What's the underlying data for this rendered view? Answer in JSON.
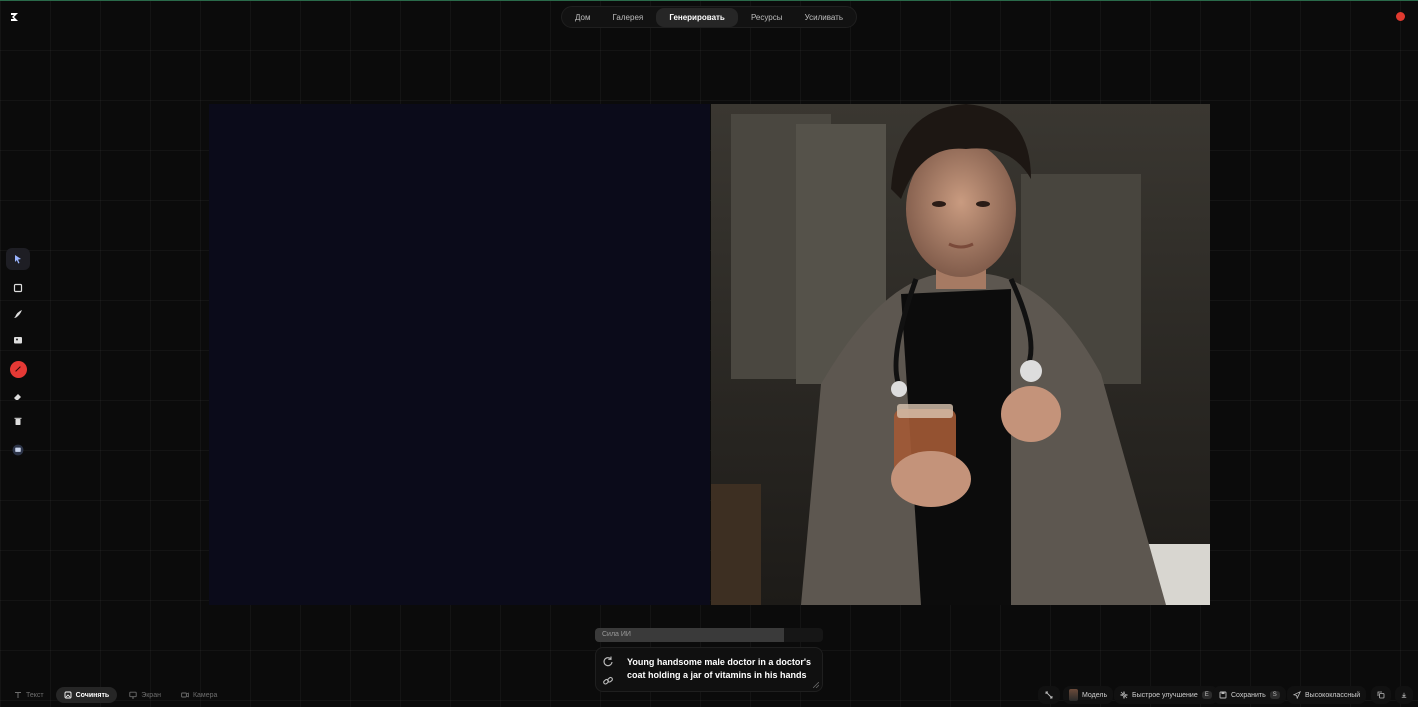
{
  "header": {
    "tabs": [
      {
        "label": "Дом"
      },
      {
        "label": "Галерея"
      },
      {
        "label": "Генерировать",
        "active": true
      },
      {
        "label": "Ресурсы"
      },
      {
        "label": "Усиливать"
      }
    ],
    "accent_color": "#e03a2f"
  },
  "toolbar": {
    "tools": [
      "select-icon",
      "rectangle-icon",
      "brush-icon",
      "image-icon",
      "color-picker",
      "eraser-icon",
      "trash-icon",
      "capture-icon"
    ]
  },
  "controls": {
    "ai_strength_label": "Сила ИИ",
    "ai_strength_value": 0.83,
    "prompt_text": "Young handsome male doctor in a doctor's coat holding a jar of vitamins in his hands"
  },
  "bottom_left": {
    "modes": [
      {
        "label": "Текст",
        "icon": "text-icon"
      },
      {
        "label": "Сочинять",
        "icon": "compose-icon",
        "active": true
      },
      {
        "label": "Экран",
        "icon": "screen-icon"
      },
      {
        "label": "Камера",
        "icon": "camera-icon"
      }
    ]
  },
  "bottom_right": {
    "model_label": "Модель",
    "fast_improve_label": "Быстрое улучшение",
    "fast_improve_badge": "E",
    "save_label": "Сохранить",
    "save_badge": "S",
    "quality_label": "Высококлассный"
  }
}
